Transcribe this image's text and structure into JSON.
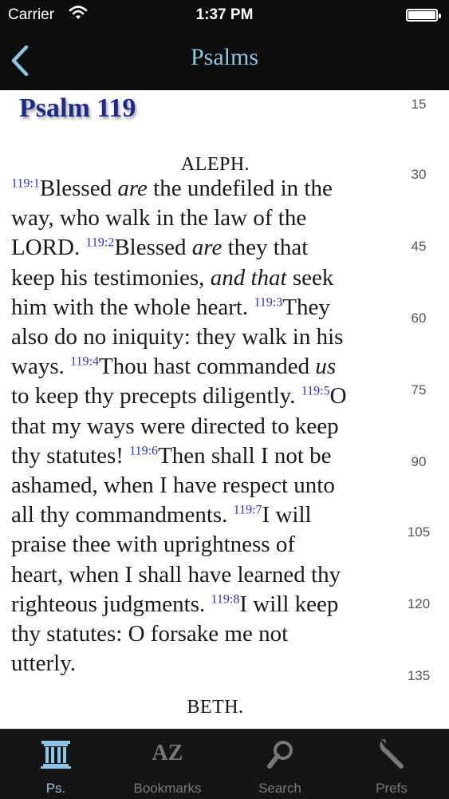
{
  "status_bar": {
    "carrier": "Carrier",
    "time": "1:37 PM"
  },
  "nav": {
    "title": "Psalms"
  },
  "content": {
    "psalm_title": "Psalm 119",
    "heading_aleph": "ALEPH.",
    "heading_beth": "BETH.",
    "line_numbers": [
      "15",
      "30",
      "45",
      "60",
      "75",
      "90",
      "105",
      "120",
      "135"
    ],
    "lines": [
      [
        [
          "v",
          "119:1"
        ],
        [
          "t",
          "Blessed "
        ],
        [
          "i",
          "are"
        ],
        [
          "t",
          " the undefiled in the"
        ]
      ],
      [
        [
          "t",
          "way, who walk in the law of the"
        ]
      ],
      [
        [
          "t",
          "LORD. "
        ],
        [
          "v",
          "119:2"
        ],
        [
          "t",
          "Blessed "
        ],
        [
          "i",
          "are"
        ],
        [
          "t",
          " they that"
        ]
      ],
      [
        [
          "t",
          "keep his testimonies, "
        ],
        [
          "i",
          "and that"
        ],
        [
          "t",
          " seek"
        ]
      ],
      [
        [
          "t",
          "him with the whole heart. "
        ],
        [
          "v",
          "119:3"
        ],
        [
          "t",
          "They"
        ]
      ],
      [
        [
          "t",
          "also do no iniquity: they walk in his"
        ]
      ],
      [
        [
          "t",
          "ways. "
        ],
        [
          "v",
          "119:4"
        ],
        [
          "t",
          "Thou hast commanded "
        ],
        [
          "i",
          "us"
        ]
      ],
      [
        [
          "t",
          "to keep thy precepts diligently. "
        ],
        [
          "v",
          "119:5"
        ],
        [
          "t",
          "O"
        ]
      ],
      [
        [
          "t",
          "that my ways were directed to keep"
        ]
      ],
      [
        [
          "t",
          "thy statutes! "
        ],
        [
          "v",
          "119:6"
        ],
        [
          "t",
          "Then shall I not be"
        ]
      ],
      [
        [
          "t",
          "ashamed, when I have respect unto"
        ]
      ],
      [
        [
          "t",
          "all thy commandments. "
        ],
        [
          "v",
          "119:7"
        ],
        [
          "t",
          "I will"
        ]
      ],
      [
        [
          "t",
          "praise thee with uprightness of"
        ]
      ],
      [
        [
          "t",
          "heart, when I shall have learned thy"
        ]
      ],
      [
        [
          "t",
          "righteous judgments. "
        ],
        [
          "v",
          "119:8"
        ],
        [
          "t",
          "I will keep"
        ]
      ],
      [
        [
          "t",
          "thy statutes: O forsake me not"
        ]
      ],
      [
        [
          "t",
          "utterly."
        ]
      ]
    ]
  },
  "tabbar": {
    "tabs": [
      {
        "label": "Ps.",
        "icon": "pillar-icon",
        "active": true
      },
      {
        "label": "Bookmarks",
        "icon": "az-icon",
        "icon_text": "AZ",
        "active": false
      },
      {
        "label": "Search",
        "icon": "magnifier-icon",
        "active": false
      },
      {
        "label": "Prefs",
        "icon": "wrench-icon",
        "active": false
      }
    ]
  },
  "colors": {
    "accent": "#8fc5e6",
    "verse_number": "#2b2fd6",
    "psalm_title": "#1d2a8c",
    "bar_bg": "#0d0d0d"
  }
}
